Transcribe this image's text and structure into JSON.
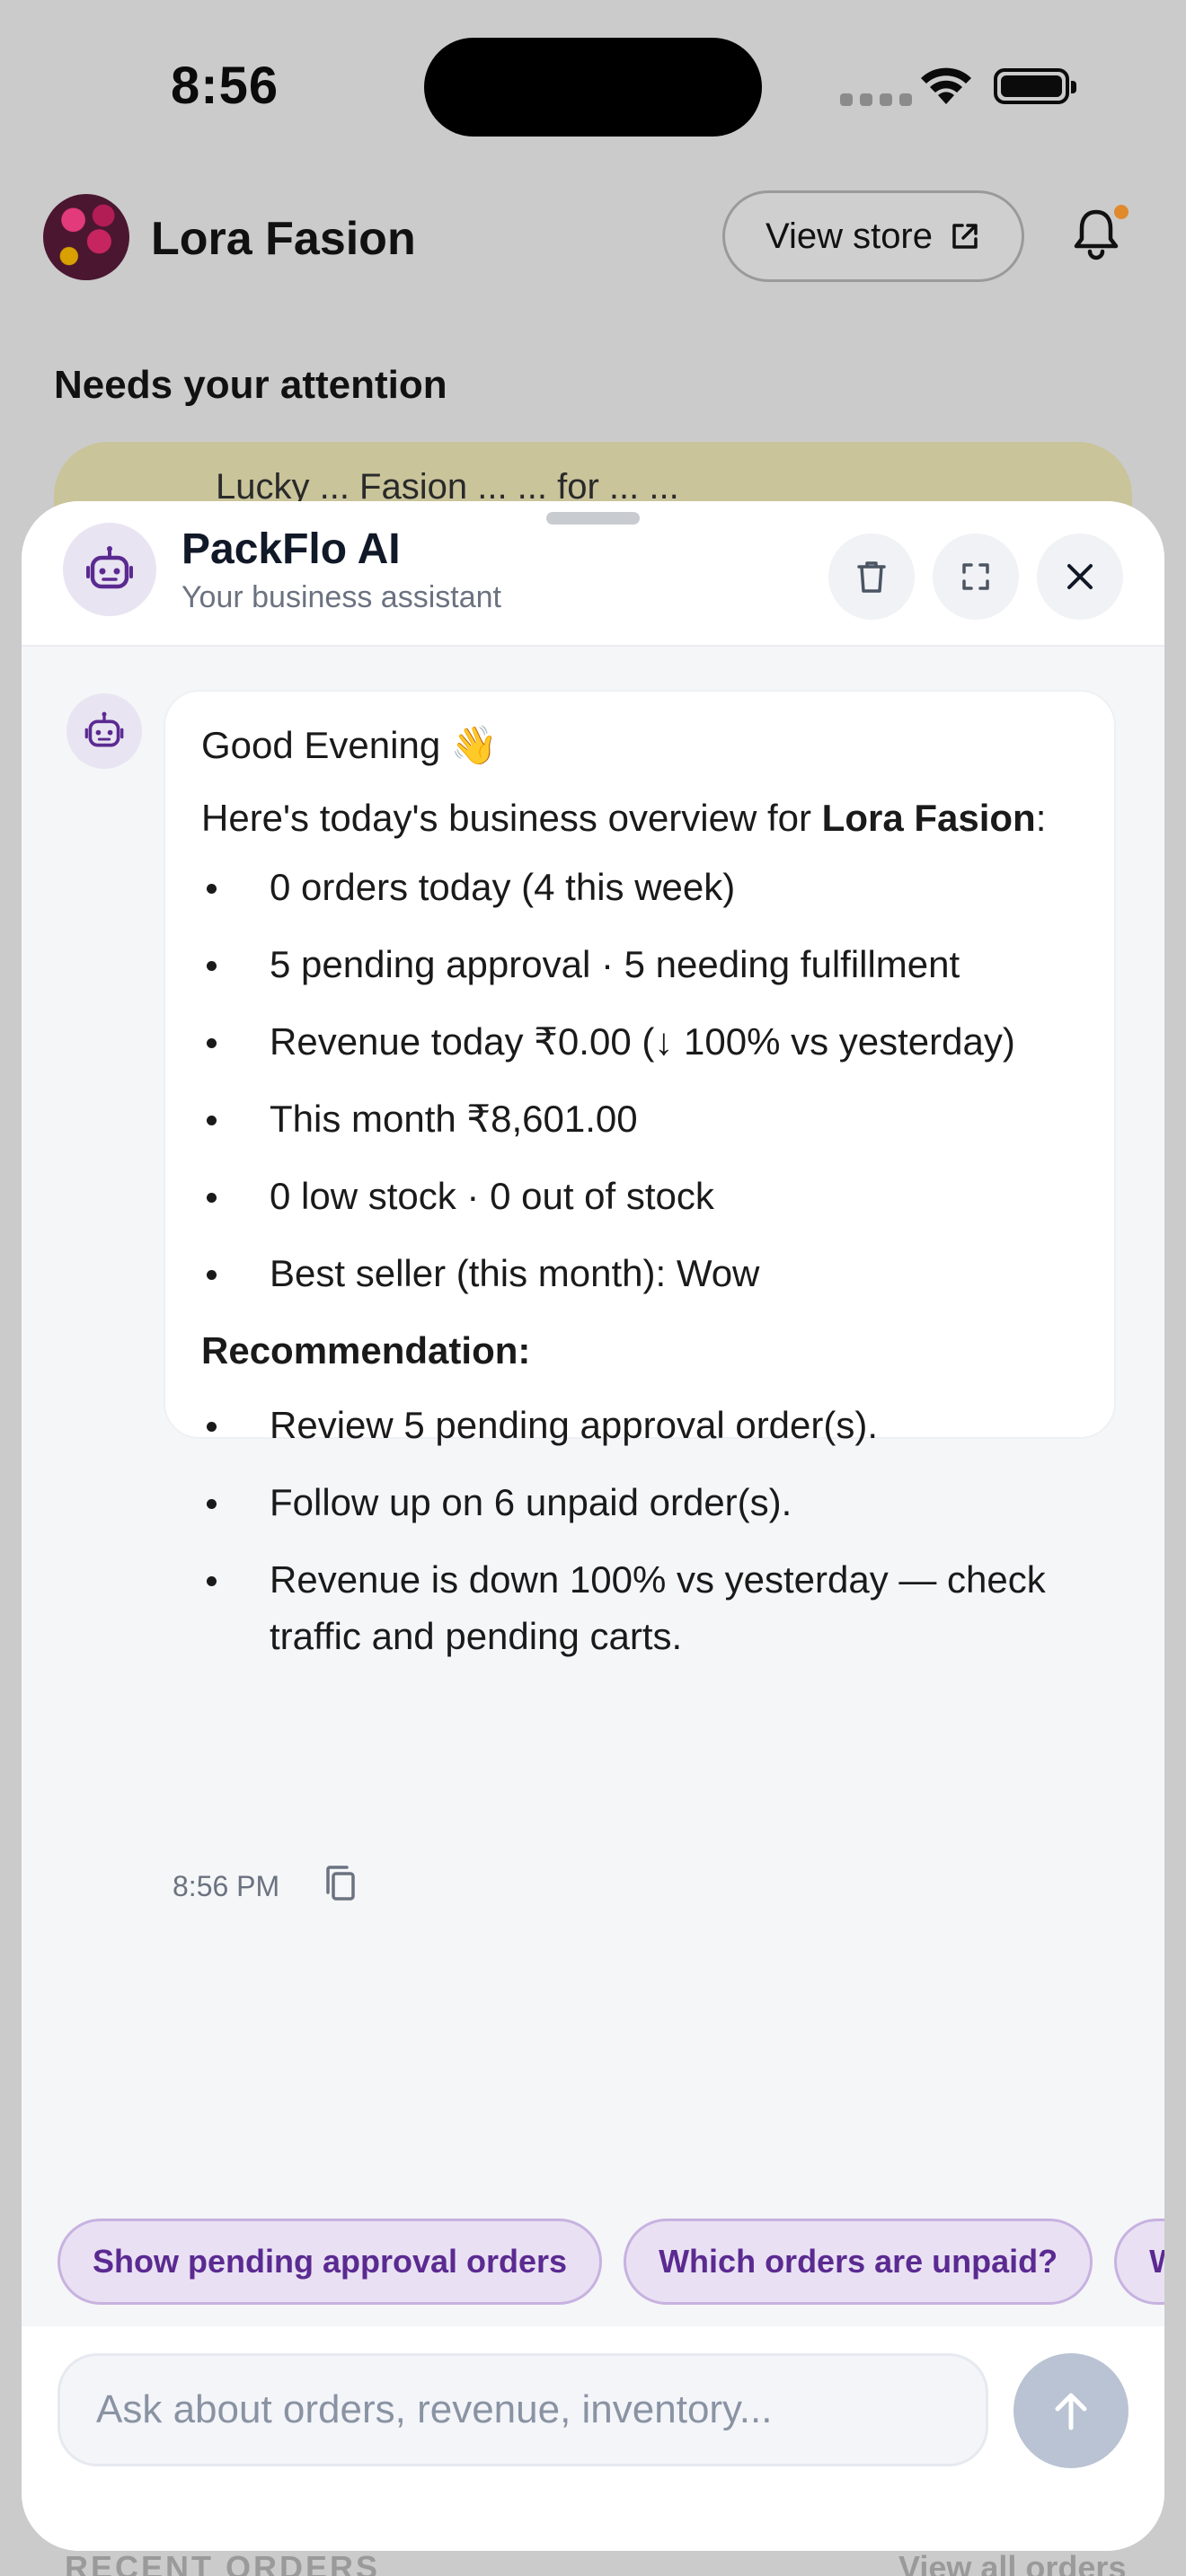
{
  "status_bar": {
    "time": "8:56"
  },
  "background": {
    "store_name": "Lora Fasion",
    "view_store_label": "View store",
    "attention_title": "Needs your attention",
    "attention_card_text": "Lucky ... Fasion ... ... for ... ...",
    "peek_left": "RECENT ORDERS",
    "peek_right": "View all orders",
    "accent_notification": "#e08a2c"
  },
  "chat": {
    "assistant_name": "PackFlo AI",
    "assistant_subtitle": "Your business assistant",
    "message": {
      "greeting": "Good Evening",
      "greeting_emoji": "👋",
      "overview_prefix": "Here's today's business overview for ",
      "overview_store": "Lora Fasion",
      "overview_suffix": ":",
      "stats": [
        "0 orders today (4 this week)",
        "5 pending approval · 5 needing fulfillment",
        "Revenue today ₹0.00 (↓ 100% vs yesterday)",
        "This month ₹8,601.00",
        "0 low stock · 0 out of stock",
        "Best seller (this month): Wow"
      ],
      "recommendation_heading": "Recommendation:",
      "recommendations": [
        "Review 5 pending approval order(s).",
        "Follow up on 6 unpaid order(s).",
        "Revenue is down 100% vs yesterday — check traffic and pending carts."
      ],
      "time": "8:56 PM"
    },
    "suggestions": [
      "Show pending approval orders",
      "Which orders are unpaid?",
      "What sold best this month?"
    ],
    "input_placeholder": "Ask about orders, revenue, inventory...",
    "colors": {
      "accent": "#5b2a91",
      "chip_bg": "#e9e1f3",
      "send_disabled": "#b9c3d3"
    }
  }
}
